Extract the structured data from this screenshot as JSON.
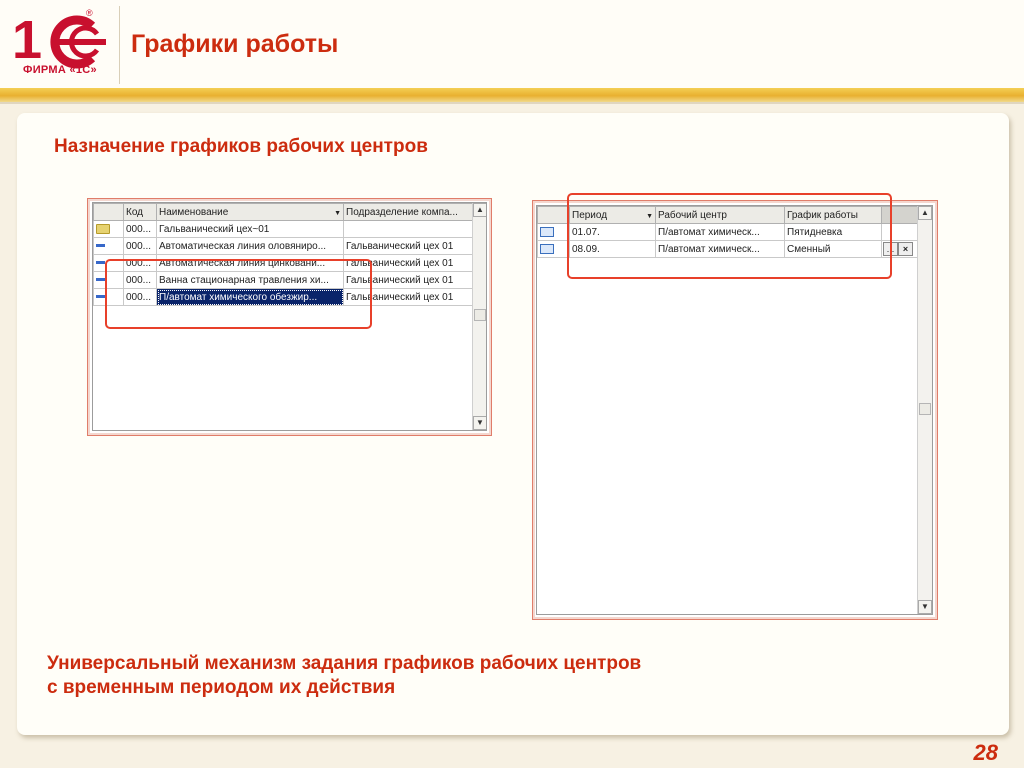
{
  "logo": {
    "brand_mark": "1С",
    "company_text": "ФИРМА «1С»",
    "registered_mark": "®"
  },
  "slide": {
    "title": "Графики работы",
    "subtitle": "Назначение графиков рабочих центров",
    "footer_line1": "Универсальный механизм задания графиков рабочих центров",
    "footer_line2": "с временным периодом их действия",
    "page_number": "28"
  },
  "left_grid": {
    "columns": [
      "Код",
      "Наименование",
      "Подразделение компа..."
    ],
    "rows": [
      {
        "icon": "folder-icon",
        "code": "000...",
        "name": "Гальванический цех~01",
        "dept": ""
      },
      {
        "icon": "item-dash-icon",
        "code": "000...",
        "name": "Автоматическая линия оловяниро...",
        "dept": "Гальванический цех 01"
      },
      {
        "icon": "item-dash-icon",
        "code": "000...",
        "name": "Автоматическая линия цинковани...",
        "dept": "Гальванический цех 01"
      },
      {
        "icon": "item-dash-icon",
        "code": "000...",
        "name": "Ванна стационарная травления хи...",
        "dept": "Гальванический цех 01"
      },
      {
        "icon": "item-dash-icon",
        "code": "000...",
        "name": "П/автомат химического обезжир...",
        "dept": "Гальванический цех 01"
      }
    ]
  },
  "right_grid": {
    "columns": [
      "Период",
      "Рабочий центр",
      "График работы"
    ],
    "rows": [
      {
        "icon": "record-icon",
        "period": "01.07.",
        "center": "П/автомат химическ...",
        "schedule": "Пятидневка"
      },
      {
        "icon": "record-icon",
        "period": "08.09.",
        "center": "П/автомат химическ...",
        "schedule": "Сменный"
      }
    ],
    "select_button": "...",
    "clear_button": "×"
  },
  "colors": {
    "title_red": "#cc2c0f",
    "highlight_red": "#e8402a",
    "selection_navy": "#0a246a",
    "band_gold": "#e9b030"
  }
}
